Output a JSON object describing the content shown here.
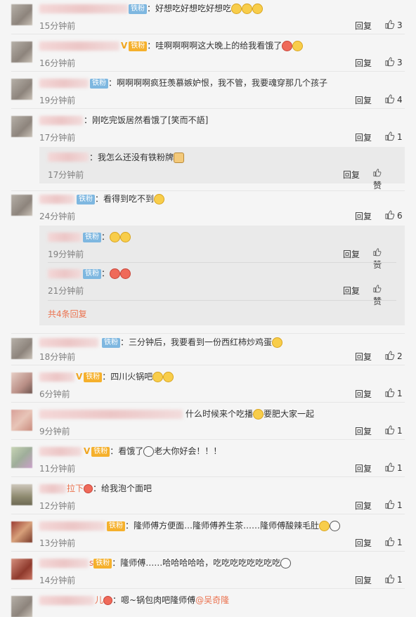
{
  "labels": {
    "reply": "回复",
    "zan": "赞",
    "more_replies": "共4条回复"
  },
  "colors": {
    "badge_blue": "#7eb7e0",
    "badge_gold": "#f5b02c",
    "mention": "#eb7350",
    "time": "#808080"
  },
  "comments": [
    {
      "badge": "铁粉",
      "text": "：好想吃好想吃好想吃",
      "time": "15分钟前",
      "likes": "3"
    },
    {
      "badge": "铁粉",
      "text": "：哇啊啊啊啊这大晚上的给我看饿了",
      "time": "16分钟前",
      "likes": "3"
    },
    {
      "badge": "铁粉",
      "text": "：啊啊啊啊疯狂羡慕嫉妒恨，我不管，我要魂穿那几个孩子",
      "time": "19分钟前",
      "likes": "4"
    },
    {
      "text": "：刚吃完饭居然看饿了[笑而不語]",
      "time": "17分钟前",
      "likes": "1",
      "sub": [
        {
          "text": "：我怎么还没有铁粉牌",
          "time": "17分钟前"
        }
      ]
    },
    {
      "badge": "铁粉",
      "text": "：看得到吃不到",
      "time": "24分钟前",
      "likes": "6",
      "sub": [
        {
          "badge": "铁粉",
          "text": "：",
          "time": "19分钟前"
        },
        {
          "badge": "铁粉",
          "text": "：",
          "time": "21分钟前"
        }
      ]
    },
    {
      "badge": "铁粉",
      "text": "：三分钟后，我要看到一份西红柿炒鸡蛋",
      "time": "18分钟前",
      "likes": "2"
    },
    {
      "badge": "铁粉",
      "text": "：四川火锅吧",
      "time": "6分钟前",
      "likes": "1"
    },
    {
      "text": "什么时候来个吃播",
      "text2": "要肥大家一起",
      "time": "9分钟前",
      "likes": "1"
    },
    {
      "badge": "铁粉",
      "text": "：看饿了",
      "text2": "老大你好会！！！",
      "time": "11分钟前",
      "likes": "1"
    },
    {
      "name_frag": "拉下",
      "text": "：给我泡个面吧",
      "time": "12分钟前",
      "likes": "1"
    },
    {
      "badge": "铁粉",
      "text": "：隆师傅方便面…隆师傅养生茶……隆师傅酸辣毛肚",
      "time": "13分钟前",
      "likes": "1"
    },
    {
      "name_frag": "s",
      "badge": "铁粉",
      "text": "：隆师傅……哈哈哈哈哈，吃吃吃吃吃吃吃吃",
      "time": "14分钟前",
      "likes": "1"
    },
    {
      "name_frag": "儿",
      "text": "：嗯~锅包肉吧隆师傅",
      "mention": "@吴奇隆"
    }
  ]
}
